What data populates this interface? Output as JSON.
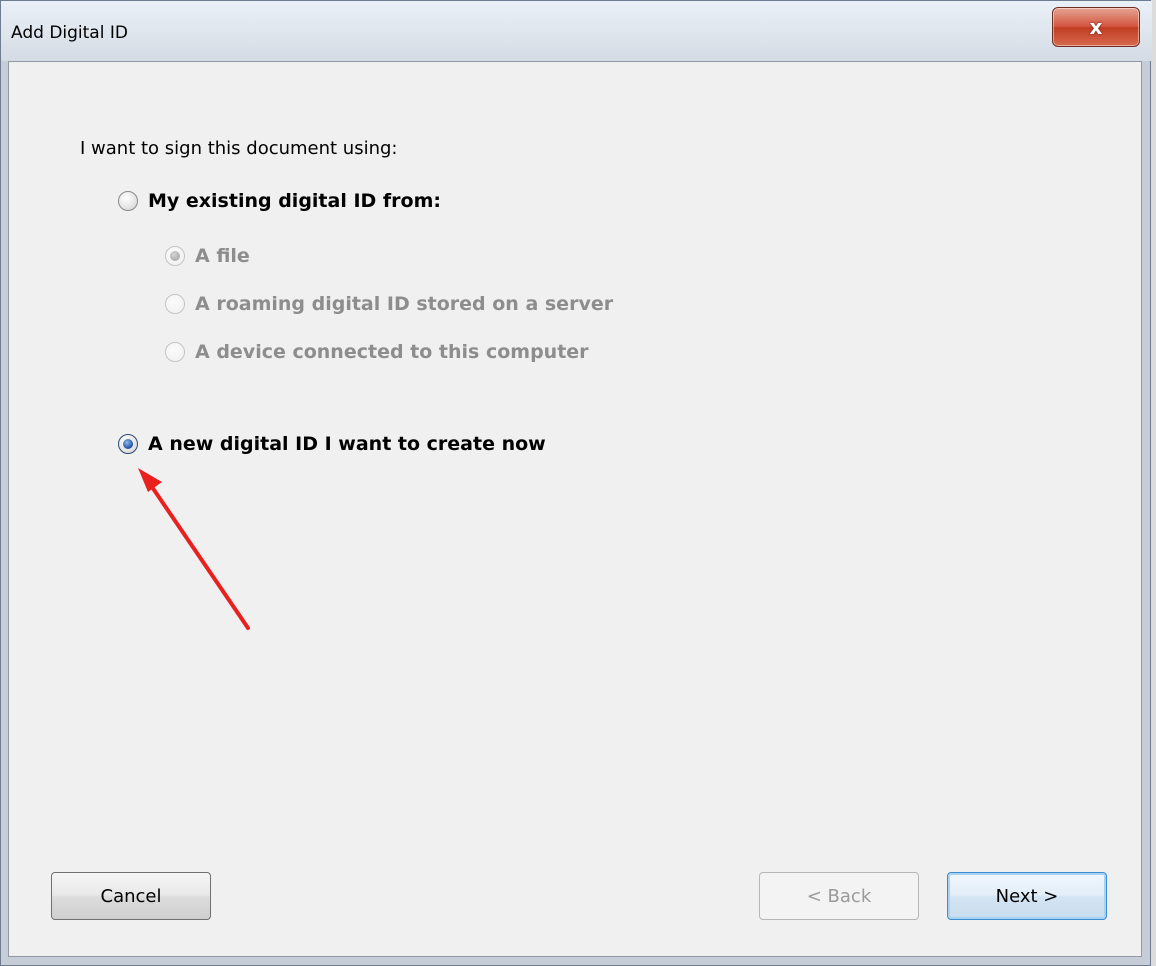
{
  "window": {
    "title": "Add Digital ID",
    "close_glyph": "x"
  },
  "dialog": {
    "prompt": "I want to sign this document using:",
    "options": {
      "existing": "My existing digital ID from:",
      "file": "A file",
      "roaming": "A roaming digital ID stored on a server",
      "device": "A device connected to this computer",
      "new_id": "A new digital ID I want to create now"
    },
    "selected": "new_id"
  },
  "buttons": {
    "cancel": "Cancel",
    "back": "< Back",
    "next": "Next >"
  },
  "annotation": {
    "arrow_color": "#e8211e",
    "arrow_target": "new_id radio"
  }
}
